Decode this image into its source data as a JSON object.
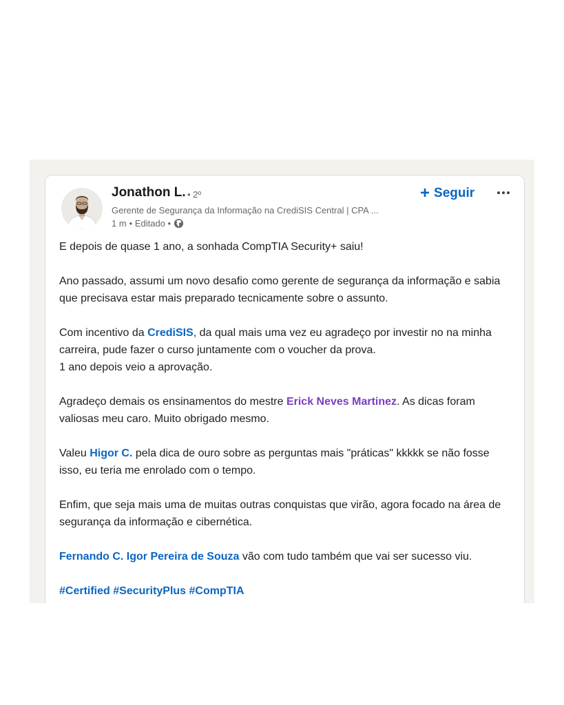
{
  "post": {
    "author": {
      "name": "Jonathon L.",
      "degree": "• 2º",
      "headline": "Gerente de Segurança da Informação na CrediSIS Central | CPA ...",
      "time": "1 m",
      "edited": "• Editado •"
    },
    "follow_label": "Seguir",
    "icons": {
      "follow": "plus-icon",
      "more": "more-options-icon",
      "visibility": "globe-icon"
    },
    "colors": {
      "link": "#0a66c2",
      "visited_link": "#7a3dbf",
      "background": "#f4f2ee"
    },
    "body": {
      "p1": "E depois de quase 1 ano, a sonhada CompTIA Security+ saiu!",
      "p2": "Ano passado, assumi um novo desafio como gerente de segurança da informação e sabia que precisava estar mais preparado tecnicamente sobre o assunto.",
      "p3_before": "Com incentivo da ",
      "p3_mention": "CrediSIS",
      "p3_after1": ", da qual mais uma vez eu agradeço por investir no na minha carreira, pude fazer o curso juntamente com o voucher da prova.",
      "p3_after2": "1 ano depois veio a aprovação.",
      "p4_before": "Agradeço demais os ensinamentos do mestre ",
      "p4_mention": "Erick Neves Martinez",
      "p4_after": ". As dicas foram valiosas meu caro. Muito obrigado mesmo.",
      "p5_before": "Valeu ",
      "p5_mention": "Higor C.",
      "p5_after": " pela dica de ouro sobre as perguntas mais \"práticas\" kkkkk se não fosse isso, eu teria me enrolado com o tempo.",
      "p6": "Enfim, que seja mais uma de muitas outras conquistas que virão, agora focado na área de segurança da informação e cibernética.",
      "p7_mention1": "Fernando C.",
      "p7_mention2": "Igor Pereira de Souza",
      "p7_after": " vão com tudo também que vai ser sucesso viu.",
      "hashtags": [
        "#Certified",
        "#SecurityPlus",
        "#CompTIA"
      ]
    }
  }
}
